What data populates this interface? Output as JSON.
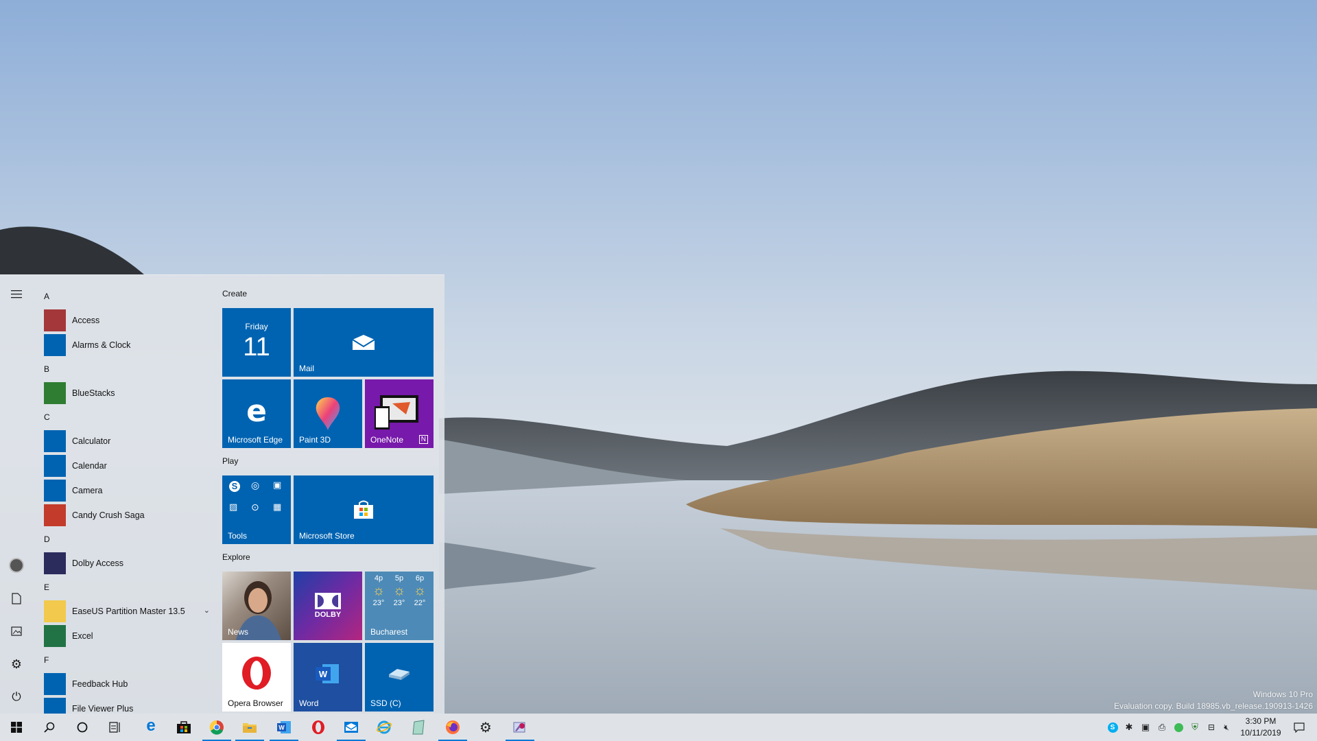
{
  "start_menu": {
    "app_groups": [
      {
        "letter": "A",
        "apps": [
          {
            "label": "Access",
            "icon": "access-icon",
            "color": "#a4373a"
          },
          {
            "label": "Alarms & Clock",
            "icon": "alarms-clock-icon",
            "color": "#0063b1"
          }
        ]
      },
      {
        "letter": "B",
        "apps": [
          {
            "label": "BlueStacks",
            "icon": "bluestacks-icon",
            "color": "#2f7d32"
          }
        ]
      },
      {
        "letter": "C",
        "apps": [
          {
            "label": "Calculator",
            "icon": "calculator-icon",
            "color": "#0063b1"
          },
          {
            "label": "Calendar",
            "icon": "calendar-icon",
            "color": "#0063b1"
          },
          {
            "label": "Camera",
            "icon": "camera-icon",
            "color": "#0063b1"
          },
          {
            "label": "Candy Crush Saga",
            "icon": "candy-crush-icon",
            "color": "#c33b2b"
          }
        ]
      },
      {
        "letter": "D",
        "apps": [
          {
            "label": "Dolby Access",
            "icon": "dolby-access-icon",
            "color": "#2b2b5c"
          }
        ]
      },
      {
        "letter": "E",
        "apps": [
          {
            "label": "EaseUS Partition Master 13.5",
            "icon": "folder-icon",
            "color": "#f2c94c",
            "expandable": true
          },
          {
            "label": "Excel",
            "icon": "excel-icon",
            "color": "#217346"
          }
        ]
      },
      {
        "letter": "F",
        "apps": [
          {
            "label": "Feedback Hub",
            "icon": "feedback-hub-icon",
            "color": "#0063b1"
          },
          {
            "label": "File Viewer Plus",
            "icon": "file-viewer-icon",
            "color": "#0063b1"
          }
        ]
      }
    ],
    "tile_groups": {
      "create": "Create",
      "play": "Play",
      "explore": "Explore"
    },
    "tiles": {
      "calendar_day": "Friday",
      "calendar_date": "11",
      "mail": "Mail",
      "edge": "Microsoft Edge",
      "paint3d": "Paint 3D",
      "onenote": "OneNote",
      "tools": "Tools",
      "store": "Microsoft Store",
      "news": "News",
      "dolby_text": "DOLBY",
      "weather_times": [
        "4p",
        "5p",
        "6p"
      ],
      "weather_temps": [
        "23°",
        "23°",
        "22°"
      ],
      "weather_city": "Bucharest",
      "opera": "Opera Browser",
      "word": "Word",
      "ssd": "SSD (C)"
    }
  },
  "watermark": {
    "line1": "Windows 10 Pro",
    "line2": "Evaluation copy. Build 18985.vb_release.190913-1426"
  },
  "taskbar": {
    "pinned": [
      "start-icon",
      "search-icon",
      "cortana-icon",
      "task-view-icon",
      "edge-icon",
      "store-icon",
      "chrome-icon",
      "file-explorer-icon",
      "word-icon",
      "opera-icon",
      "mail-icon",
      "ie-icon",
      "notepad-icon",
      "firefox-icon",
      "settings-icon",
      "paint-icon"
    ],
    "time": "3:30 PM",
    "date": "10/11/2019"
  },
  "colors": {
    "accent": "#0063b1",
    "taskbar_indicator": "#0078d7"
  }
}
